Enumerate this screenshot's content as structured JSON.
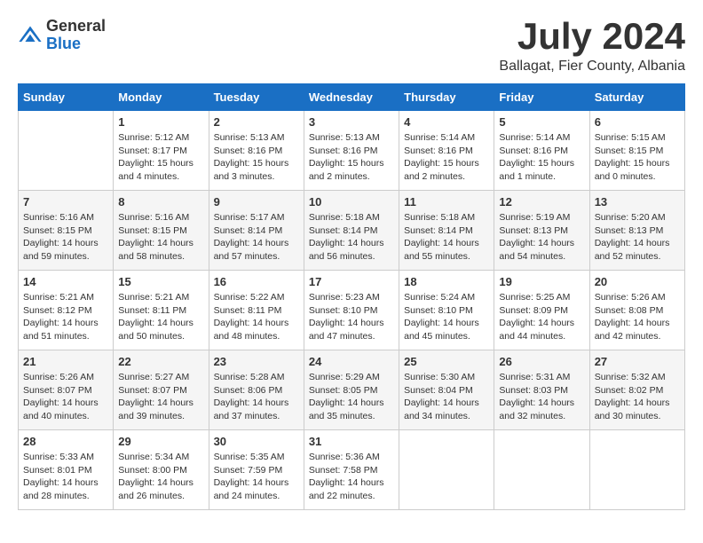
{
  "logo": {
    "general": "General",
    "blue": "Blue"
  },
  "title": {
    "month_year": "July 2024",
    "location": "Ballagat, Fier County, Albania"
  },
  "days_of_week": [
    "Sunday",
    "Monday",
    "Tuesday",
    "Wednesday",
    "Thursday",
    "Friday",
    "Saturday"
  ],
  "weeks": [
    {
      "days": [
        {
          "number": "",
          "content": ""
        },
        {
          "number": "1",
          "content": "Sunrise: 5:12 AM\nSunset: 8:17 PM\nDaylight: 15 hours\nand 4 minutes."
        },
        {
          "number": "2",
          "content": "Sunrise: 5:13 AM\nSunset: 8:16 PM\nDaylight: 15 hours\nand 3 minutes."
        },
        {
          "number": "3",
          "content": "Sunrise: 5:13 AM\nSunset: 8:16 PM\nDaylight: 15 hours\nand 2 minutes."
        },
        {
          "number": "4",
          "content": "Sunrise: 5:14 AM\nSunset: 8:16 PM\nDaylight: 15 hours\nand 2 minutes."
        },
        {
          "number": "5",
          "content": "Sunrise: 5:14 AM\nSunset: 8:16 PM\nDaylight: 15 hours\nand 1 minute."
        },
        {
          "number": "6",
          "content": "Sunrise: 5:15 AM\nSunset: 8:15 PM\nDaylight: 15 hours\nand 0 minutes."
        }
      ]
    },
    {
      "days": [
        {
          "number": "7",
          "content": "Sunrise: 5:16 AM\nSunset: 8:15 PM\nDaylight: 14 hours\nand 59 minutes."
        },
        {
          "number": "8",
          "content": "Sunrise: 5:16 AM\nSunset: 8:15 PM\nDaylight: 14 hours\nand 58 minutes."
        },
        {
          "number": "9",
          "content": "Sunrise: 5:17 AM\nSunset: 8:14 PM\nDaylight: 14 hours\nand 57 minutes."
        },
        {
          "number": "10",
          "content": "Sunrise: 5:18 AM\nSunset: 8:14 PM\nDaylight: 14 hours\nand 56 minutes."
        },
        {
          "number": "11",
          "content": "Sunrise: 5:18 AM\nSunset: 8:14 PM\nDaylight: 14 hours\nand 55 minutes."
        },
        {
          "number": "12",
          "content": "Sunrise: 5:19 AM\nSunset: 8:13 PM\nDaylight: 14 hours\nand 54 minutes."
        },
        {
          "number": "13",
          "content": "Sunrise: 5:20 AM\nSunset: 8:13 PM\nDaylight: 14 hours\nand 52 minutes."
        }
      ]
    },
    {
      "days": [
        {
          "number": "14",
          "content": "Sunrise: 5:21 AM\nSunset: 8:12 PM\nDaylight: 14 hours\nand 51 minutes."
        },
        {
          "number": "15",
          "content": "Sunrise: 5:21 AM\nSunset: 8:11 PM\nDaylight: 14 hours\nand 50 minutes."
        },
        {
          "number": "16",
          "content": "Sunrise: 5:22 AM\nSunset: 8:11 PM\nDaylight: 14 hours\nand 48 minutes."
        },
        {
          "number": "17",
          "content": "Sunrise: 5:23 AM\nSunset: 8:10 PM\nDaylight: 14 hours\nand 47 minutes."
        },
        {
          "number": "18",
          "content": "Sunrise: 5:24 AM\nSunset: 8:10 PM\nDaylight: 14 hours\nand 45 minutes."
        },
        {
          "number": "19",
          "content": "Sunrise: 5:25 AM\nSunset: 8:09 PM\nDaylight: 14 hours\nand 44 minutes."
        },
        {
          "number": "20",
          "content": "Sunrise: 5:26 AM\nSunset: 8:08 PM\nDaylight: 14 hours\nand 42 minutes."
        }
      ]
    },
    {
      "days": [
        {
          "number": "21",
          "content": "Sunrise: 5:26 AM\nSunset: 8:07 PM\nDaylight: 14 hours\nand 40 minutes."
        },
        {
          "number": "22",
          "content": "Sunrise: 5:27 AM\nSunset: 8:07 PM\nDaylight: 14 hours\nand 39 minutes."
        },
        {
          "number": "23",
          "content": "Sunrise: 5:28 AM\nSunset: 8:06 PM\nDaylight: 14 hours\nand 37 minutes."
        },
        {
          "number": "24",
          "content": "Sunrise: 5:29 AM\nSunset: 8:05 PM\nDaylight: 14 hours\nand 35 minutes."
        },
        {
          "number": "25",
          "content": "Sunrise: 5:30 AM\nSunset: 8:04 PM\nDaylight: 14 hours\nand 34 minutes."
        },
        {
          "number": "26",
          "content": "Sunrise: 5:31 AM\nSunset: 8:03 PM\nDaylight: 14 hours\nand 32 minutes."
        },
        {
          "number": "27",
          "content": "Sunrise: 5:32 AM\nSunset: 8:02 PM\nDaylight: 14 hours\nand 30 minutes."
        }
      ]
    },
    {
      "days": [
        {
          "number": "28",
          "content": "Sunrise: 5:33 AM\nSunset: 8:01 PM\nDaylight: 14 hours\nand 28 minutes."
        },
        {
          "number": "29",
          "content": "Sunrise: 5:34 AM\nSunset: 8:00 PM\nDaylight: 14 hours\nand 26 minutes."
        },
        {
          "number": "30",
          "content": "Sunrise: 5:35 AM\nSunset: 7:59 PM\nDaylight: 14 hours\nand 24 minutes."
        },
        {
          "number": "31",
          "content": "Sunrise: 5:36 AM\nSunset: 7:58 PM\nDaylight: 14 hours\nand 22 minutes."
        },
        {
          "number": "",
          "content": ""
        },
        {
          "number": "",
          "content": ""
        },
        {
          "number": "",
          "content": ""
        }
      ]
    }
  ]
}
